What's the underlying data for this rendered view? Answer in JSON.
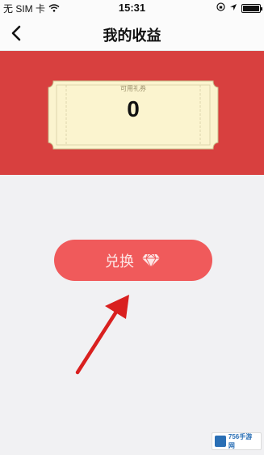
{
  "status_bar": {
    "carrier": "无 SIM 卡",
    "time": "15:31"
  },
  "nav": {
    "title": "我的收益",
    "back_icon": "chevron-left-icon"
  },
  "ticket": {
    "label": "可用礼券",
    "value": "0"
  },
  "exchange_button": {
    "label": "兑换",
    "icon": "diamond-icon"
  },
  "watermark": {
    "text": "756手游网"
  },
  "colors": {
    "banner": "#d8403f",
    "button": "#f05a5b",
    "ticket": "#fbf4cf",
    "background": "#f1f1f3",
    "arrow": "#d9201f"
  }
}
